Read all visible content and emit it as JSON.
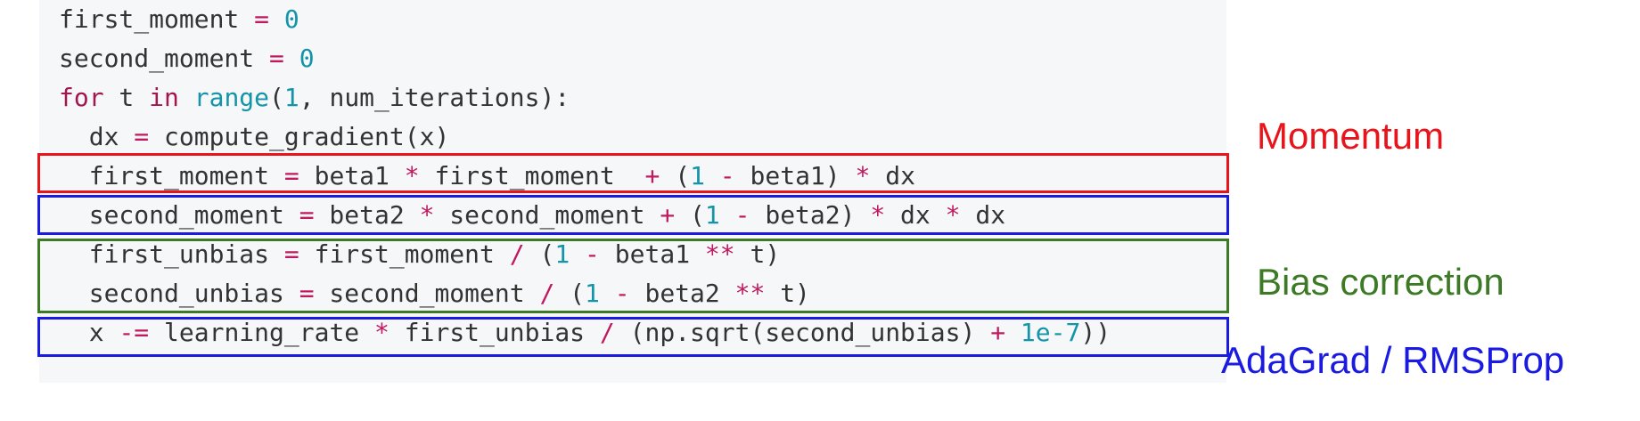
{
  "colors": {
    "code_background": "#f6f7f8",
    "momentum": "#e8141b",
    "second_moment": "#1a1ae0",
    "bias_correction": "#3c7a25",
    "adagrad_rmsprop": "#1a1ae0",
    "keyword": "#a3154f",
    "operator": "#c0195f",
    "number": "#1394a9",
    "builtin": "#1394a9",
    "plain": "#333333"
  },
  "code": {
    "lines": [
      [
        {
          "t": "first_moment ",
          "c": "plain"
        },
        {
          "t": "=",
          "c": "op"
        },
        {
          "t": " ",
          "c": "plain"
        },
        {
          "t": "0",
          "c": "num"
        }
      ],
      [
        {
          "t": "second_moment ",
          "c": "plain"
        },
        {
          "t": "=",
          "c": "op"
        },
        {
          "t": " ",
          "c": "plain"
        },
        {
          "t": "0",
          "c": "num"
        }
      ],
      [
        {
          "t": "for",
          "c": "kw"
        },
        {
          "t": " t ",
          "c": "plain"
        },
        {
          "t": "in",
          "c": "kw"
        },
        {
          "t": " ",
          "c": "plain"
        },
        {
          "t": "range",
          "c": "fn"
        },
        {
          "t": "(",
          "c": "plain"
        },
        {
          "t": "1",
          "c": "num"
        },
        {
          "t": ", num_iterations):",
          "c": "plain"
        }
      ],
      [
        {
          "t": "  dx ",
          "c": "plain"
        },
        {
          "t": "=",
          "c": "op"
        },
        {
          "t": " compute_gradient(x)",
          "c": "plain"
        }
      ],
      [
        {
          "t": "  first_moment ",
          "c": "plain"
        },
        {
          "t": "=",
          "c": "op"
        },
        {
          "t": " beta1 ",
          "c": "plain"
        },
        {
          "t": "*",
          "c": "op"
        },
        {
          "t": " first_moment  ",
          "c": "plain"
        },
        {
          "t": "+",
          "c": "op"
        },
        {
          "t": " (",
          "c": "plain"
        },
        {
          "t": "1",
          "c": "num"
        },
        {
          "t": " ",
          "c": "plain"
        },
        {
          "t": "-",
          "c": "op"
        },
        {
          "t": " beta1) ",
          "c": "plain"
        },
        {
          "t": "*",
          "c": "op"
        },
        {
          "t": " dx",
          "c": "plain"
        }
      ],
      [
        {
          "t": "  second_moment ",
          "c": "plain"
        },
        {
          "t": "=",
          "c": "op"
        },
        {
          "t": " beta2 ",
          "c": "plain"
        },
        {
          "t": "*",
          "c": "op"
        },
        {
          "t": " second_moment ",
          "c": "plain"
        },
        {
          "t": "+",
          "c": "op"
        },
        {
          "t": " (",
          "c": "plain"
        },
        {
          "t": "1",
          "c": "num"
        },
        {
          "t": " ",
          "c": "plain"
        },
        {
          "t": "-",
          "c": "op"
        },
        {
          "t": " beta2) ",
          "c": "plain"
        },
        {
          "t": "*",
          "c": "op"
        },
        {
          "t": " dx ",
          "c": "plain"
        },
        {
          "t": "*",
          "c": "op"
        },
        {
          "t": " dx",
          "c": "plain"
        }
      ],
      [
        {
          "t": "  first_unbias ",
          "c": "plain"
        },
        {
          "t": "=",
          "c": "op"
        },
        {
          "t": " first_moment ",
          "c": "plain"
        },
        {
          "t": "/",
          "c": "op"
        },
        {
          "t": " (",
          "c": "plain"
        },
        {
          "t": "1",
          "c": "num"
        },
        {
          "t": " ",
          "c": "plain"
        },
        {
          "t": "-",
          "c": "op"
        },
        {
          "t": " beta1 ",
          "c": "plain"
        },
        {
          "t": "**",
          "c": "op"
        },
        {
          "t": " t)",
          "c": "plain"
        }
      ],
      [
        {
          "t": "  second_unbias ",
          "c": "plain"
        },
        {
          "t": "=",
          "c": "op"
        },
        {
          "t": " second_moment ",
          "c": "plain"
        },
        {
          "t": "/",
          "c": "op"
        },
        {
          "t": " (",
          "c": "plain"
        },
        {
          "t": "1",
          "c": "num"
        },
        {
          "t": " ",
          "c": "plain"
        },
        {
          "t": "-",
          "c": "op"
        },
        {
          "t": " beta2 ",
          "c": "plain"
        },
        {
          "t": "**",
          "c": "op"
        },
        {
          "t": " t)",
          "c": "plain"
        }
      ],
      [
        {
          "t": "  x ",
          "c": "plain"
        },
        {
          "t": "-=",
          "c": "op"
        },
        {
          "t": " learning_rate ",
          "c": "plain"
        },
        {
          "t": "*",
          "c": "op"
        },
        {
          "t": " first_unbias ",
          "c": "plain"
        },
        {
          "t": "/",
          "c": "op"
        },
        {
          "t": " (np.sqrt(second_unbias) ",
          "c": "plain"
        },
        {
          "t": "+",
          "c": "op"
        },
        {
          "t": " ",
          "c": "plain"
        },
        {
          "t": "1e-7",
          "c": "num"
        },
        {
          "t": "))",
          "c": "plain"
        }
      ]
    ]
  },
  "annotations": {
    "momentum": "Momentum",
    "bias_correction": "Bias correction",
    "adagrad_rmsprop": "AdaGrad / RMSProp"
  }
}
